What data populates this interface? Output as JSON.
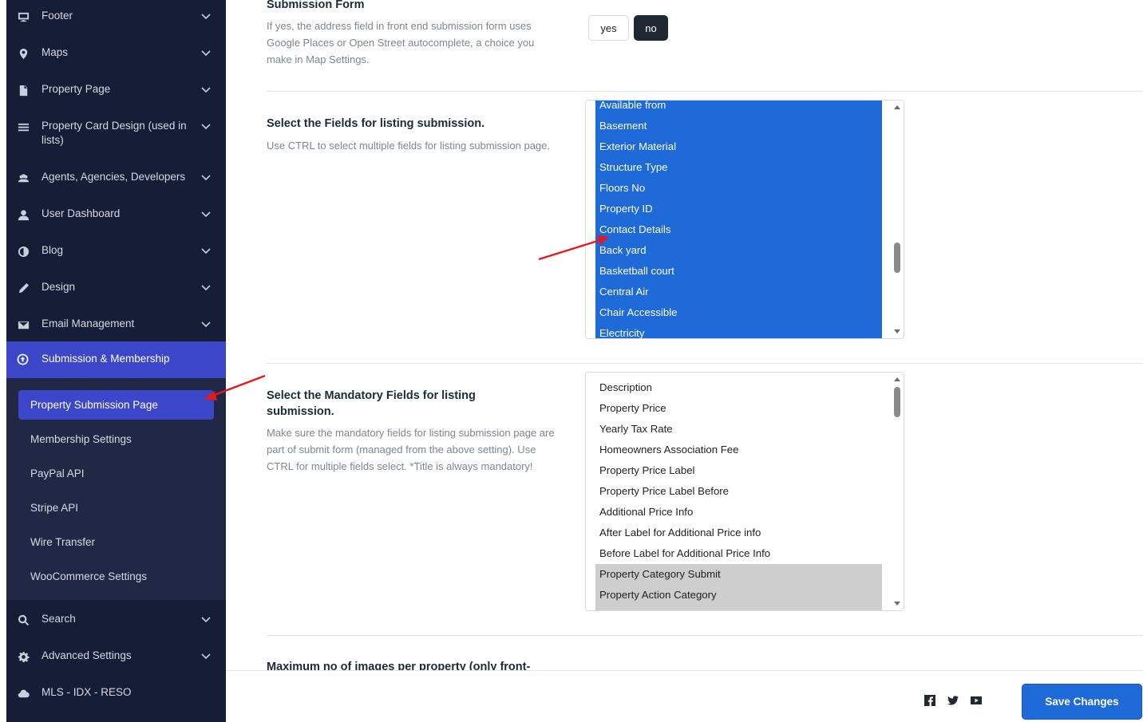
{
  "sidebar": {
    "items": [
      {
        "label": "Footer",
        "icon": "monitor-icon"
      },
      {
        "label": "Maps",
        "icon": "map-pin-icon"
      },
      {
        "label": "Property Page",
        "icon": "document-icon"
      },
      {
        "label": "Property Card Design (used in lists)",
        "icon": "list-icon"
      },
      {
        "label": "Agents, Agencies, Developers",
        "icon": "users-icon"
      },
      {
        "label": "User Dashboard",
        "icon": "user-icon"
      },
      {
        "label": "Blog",
        "icon": "contrast-icon"
      },
      {
        "label": "Design",
        "icon": "pencil-icon"
      },
      {
        "label": "Email Management",
        "icon": "envelope-icon"
      },
      {
        "label": "Submission & Membership",
        "icon": "upload-circle-icon"
      }
    ],
    "submenu": [
      {
        "label": "Property Submission Page",
        "active": true
      },
      {
        "label": "Membership Settings"
      },
      {
        "label": "PayPal API"
      },
      {
        "label": "Stripe API"
      },
      {
        "label": "Wire Transfer"
      },
      {
        "label": "WooCommerce Settings"
      }
    ],
    "bottom_items": [
      {
        "label": "Search",
        "icon": "search-icon"
      },
      {
        "label": "Advanced Settings",
        "icon": "gear-icon"
      },
      {
        "label": "MLS - IDX - RESO",
        "icon": "cloud-icon"
      }
    ]
  },
  "main": {
    "autocomplete": {
      "title": "Submission Form",
      "description": "If yes, the address field in front end submission form uses Google Places or Open Street autocomplete, a choice you make in Map Settings.",
      "yes_label": "yes",
      "no_label": "no",
      "selected": "no"
    },
    "fields": {
      "title": "Select the Fields for listing submission.",
      "description": "Use CTRL to select multiple fields for listing submission page.",
      "options": [
        "Available from",
        "Basement",
        "Exterior Material",
        "Structure Type",
        "Floors No",
        "Property ID",
        "Contact Details",
        "Back yard",
        "Basketball court",
        "Central Air",
        "Chair Accessible",
        "Electricity"
      ]
    },
    "mandatory": {
      "title": "Select the Mandatory Fields for listing submission.",
      "description": "Make sure the mandatory fields for listing submission page are part of submit form (managed from the above setting). Use CTRL for multiple fields select. *Title is always mandatory!",
      "options": [
        "Description",
        "Property Price",
        "Yearly Tax Rate",
        "Homeowners Association Fee",
        "Property Price Label",
        "Property Price Label Before",
        "Additional Price Info",
        "After Label for Additional Price info",
        "Before Label for Additional Price Info",
        "Property Category Submit",
        "Property Action Category"
      ],
      "selected": [
        "Property Category Submit",
        "Property Action Category"
      ]
    },
    "max_images": {
      "title": "Maximum no of images per property (only front-"
    }
  },
  "footer": {
    "save_label": "Save Changes",
    "social_icons": [
      "facebook-icon",
      "twitter-icon",
      "youtube-icon"
    ]
  },
  "colors": {
    "sidebar_bg": "#161d36",
    "active_bg": "#3b46c9",
    "selection_blue": "#1e6ad8",
    "annotation_arrow": "#e4191d"
  }
}
